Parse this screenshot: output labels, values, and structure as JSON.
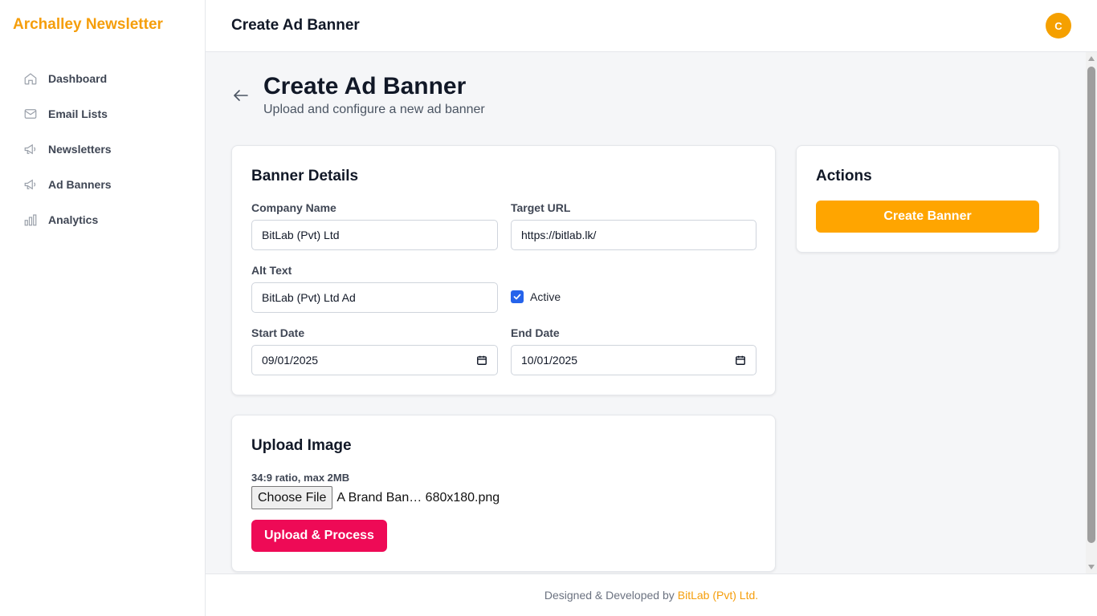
{
  "app": {
    "brand": "Archalley Newsletter",
    "accent": "#f59e0b"
  },
  "sidebar": {
    "items": [
      {
        "label": "Dashboard",
        "icon": "home-icon"
      },
      {
        "label": "Email Lists",
        "icon": "mail-icon"
      },
      {
        "label": "Newsletters",
        "icon": "megaphone-icon"
      },
      {
        "label": "Ad Banners",
        "icon": "megaphone-icon"
      },
      {
        "label": "Analytics",
        "icon": "bar-chart-icon"
      }
    ]
  },
  "header": {
    "title": "Create Ad Banner",
    "avatar_initial": "C"
  },
  "page": {
    "title": "Create Ad Banner",
    "subtitle": "Upload and configure a new ad banner"
  },
  "banner_details": {
    "title": "Banner Details",
    "company_name": {
      "label": "Company Name",
      "value": "BitLab (Pvt) Ltd"
    },
    "target_url": {
      "label": "Target URL",
      "value": "https://bitlab.lk/"
    },
    "alt_text": {
      "label": "Alt Text",
      "value": "BitLab (Pvt) Ltd Ad"
    },
    "active": {
      "label": "Active",
      "checked": true
    },
    "start_date": {
      "label": "Start Date",
      "value": "09/01/2025"
    },
    "end_date": {
      "label": "End Date",
      "value": "10/01/2025"
    }
  },
  "upload_image": {
    "title": "Upload Image",
    "hint": "34:9 ratio, max 2MB",
    "choose_label": "Choose File",
    "file_name": "A Brand Ban…  680x180.png",
    "upload_label": "Upload & Process",
    "upload_color": "#ee0a56"
  },
  "actions": {
    "title": "Actions",
    "create_label": "Create Banner",
    "create_color": "#ffa500"
  },
  "footer": {
    "text": "Designed & Developed by",
    "link": "BitLab (Pvt) Ltd."
  }
}
